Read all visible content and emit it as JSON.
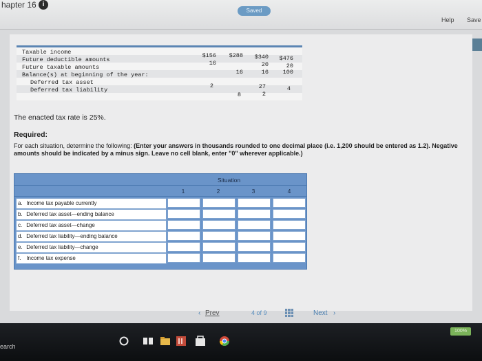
{
  "header": {
    "chapter_title": "hapter 16",
    "saved_label": "Saved",
    "help_label": "Help",
    "save_label": "Save"
  },
  "given_table": {
    "labels": [
      "Taxable income",
      "Future deductible amounts",
      "Future taxable amounts",
      "Balance(s) at beginning of the year:",
      "Deferred tax asset",
      "Deferred tax liability"
    ],
    "taxable_income": [
      "$156",
      "$288",
      "$340",
      "$476"
    ],
    "future_deductible": [
      "16",
      "",
      "20",
      "20"
    ],
    "future_taxable": [
      "",
      "16",
      "16",
      "100"
    ],
    "dta_beginning": [
      "2",
      "",
      "27",
      "4"
    ],
    "dtl_beginning": [
      "",
      "8",
      "2",
      ""
    ]
  },
  "text": {
    "rate": "The enacted tax rate is 25%.",
    "required_title": "Required:",
    "instruction_plain": "For each situation, determine the following:",
    "instruction_bold": "(Enter your answers in thousands rounded to one decimal place (i.e. 1,200 should be entered as 1.2). Negative amounts should be indicated by a minus sign. Leave no cell blank, enter \"0\" wherever applicable.)"
  },
  "answer_table": {
    "situation_label": "Situation",
    "columns": [
      "1",
      "2",
      "3",
      "4"
    ],
    "rows": [
      {
        "letter": "a.",
        "label": "Income tax payable currently"
      },
      {
        "letter": "b.",
        "label": "Deferred tax asset—ending balance"
      },
      {
        "letter": "c.",
        "label": "Deferred tax asset—change"
      },
      {
        "letter": "d.",
        "label": "Deferred tax liability—ending balance"
      },
      {
        "letter": "e.",
        "label": "Deferred tax liability—change"
      },
      {
        "letter": "f.",
        "label": "Income tax expense"
      }
    ]
  },
  "pager": {
    "prev_label": "Prev",
    "page_current": "4",
    "page_of": "of",
    "page_total": "9",
    "next_label": "Next"
  },
  "taskbar": {
    "search_text": "earch",
    "zoom_label": "100%"
  }
}
